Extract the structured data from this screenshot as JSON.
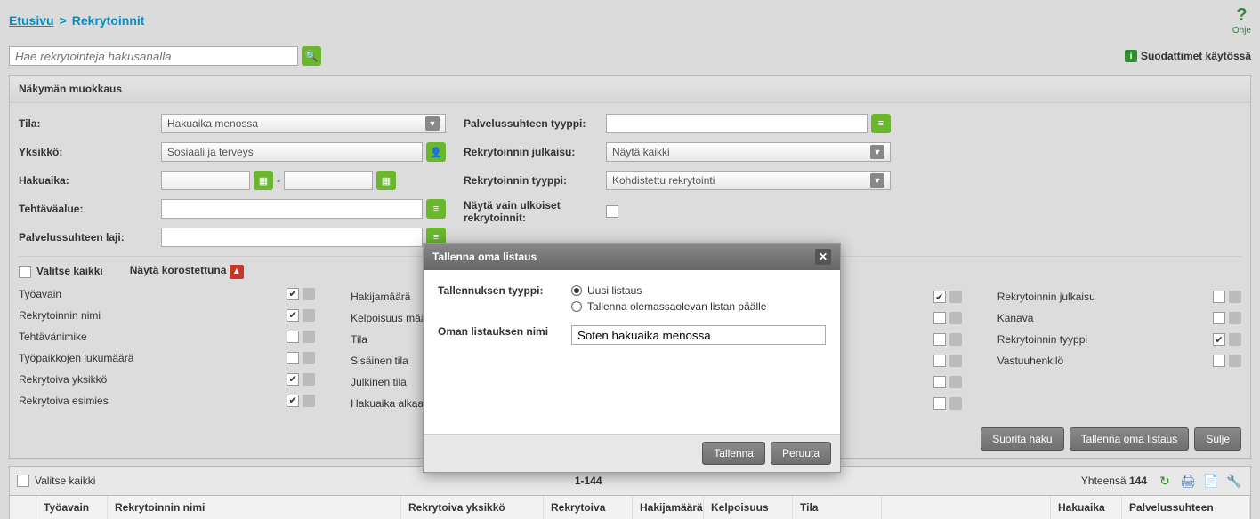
{
  "breadcrumb": {
    "home": "Etusivu",
    "sep": ">",
    "current": "Rekrytoinnit"
  },
  "help": {
    "label": "Ohje",
    "icon": "?"
  },
  "search": {
    "placeholder": "Hae rekrytointeja hakusanalla"
  },
  "filters_active": {
    "badge": "i",
    "text": "Suodattimet käytössä"
  },
  "panel": {
    "title": "Näkymän muokkaus"
  },
  "filters": {
    "tila": {
      "label": "Tila:",
      "value": "Hakuaika menossa"
    },
    "yksikko": {
      "label": "Yksikkö:",
      "value": "Sosiaali ja terveys"
    },
    "hakuaika": {
      "label": "Hakuaika:",
      "sep": "-"
    },
    "tehtavaalue": {
      "label": "Tehtäväalue:"
    },
    "palvelussuhteen_laji": {
      "label": "Palvelussuhteen laji:"
    },
    "palvelussuhteen_tyyppi": {
      "label": "Palvelussuhteen tyyppi:"
    },
    "rekrytoinnin_julkaisu": {
      "label": "Rekrytoinnin julkaisu:",
      "value": "Näytä kaikki"
    },
    "rekrytoinnin_tyyppi": {
      "label": "Rekrytoinnin tyyppi:",
      "value": "Kohdistettu rekrytointi"
    },
    "nayta_ulkoiset": {
      "label": "Näytä vain ulkoiset rekrytoinnit:"
    }
  },
  "columns": {
    "select_all": "Valitse kaikki",
    "highlight": "Näytä korostettuna",
    "col1": [
      {
        "label": "Työavain",
        "checked": true
      },
      {
        "label": "Rekrytoinnin nimi",
        "checked": true
      },
      {
        "label": "Tehtävänimike",
        "checked": false
      },
      {
        "label": "Työpaikkojen lukumäärä",
        "checked": false
      },
      {
        "label": "Rekrytoiva yksikkö",
        "checked": true
      },
      {
        "label": "Rekrytoiva esimies",
        "checked": true
      }
    ],
    "col2": [
      {
        "label": "Hakijamäärä",
        "checked": false
      },
      {
        "label": "Kelpoisuus määritelty",
        "checked": false
      },
      {
        "label": "Tila",
        "checked": false
      },
      {
        "label": "Sisäinen tila",
        "checked": false
      },
      {
        "label": "Julkinen tila",
        "checked": false
      },
      {
        "label": "Hakuaika alkaa",
        "checked": false
      }
    ],
    "col3": [
      {
        "label": "",
        "checked": true
      },
      {
        "label": "",
        "checked": false
      },
      {
        "label": "",
        "checked": false
      },
      {
        "label": "",
        "checked": false
      },
      {
        "label": "",
        "checked": false
      },
      {
        "label": "",
        "checked": false
      }
    ],
    "col4": [
      {
        "label": "Rekrytoinnin julkaisu",
        "checked": false
      },
      {
        "label": "Kanava",
        "checked": false
      },
      {
        "label": "Rekrytoinnin tyyppi",
        "checked": true
      },
      {
        "label": "Vastuuhenkilö",
        "checked": false
      }
    ]
  },
  "actions": {
    "suorita": "Suorita haku",
    "tallenna_listaus": "Tallenna oma listaus",
    "sulje": "Sulje"
  },
  "results": {
    "select_all": "Valitse kaikki",
    "page": "1-144",
    "total_label": "Yhteensä",
    "total_value": "144",
    "headers": {
      "tyoavain": "Työavain",
      "rekrytoinnin_nimi": "Rekrytoinnin nimi",
      "rekrytoiva_yksikko": "Rekrytoiva yksikkö",
      "rekrytoiva": "Rekrytoiva",
      "hakijamaara": "Hakijamäärä",
      "kelpoisuus": "Kelpoisuus",
      "tila": "Tila",
      "hakuaika": "Hakuaika",
      "palvelussuhteen": "Palvelussuhteen"
    }
  },
  "modal": {
    "title": "Tallenna oma listaus",
    "type_label": "Tallennuksen tyyppi:",
    "radio_new": "Uusi listaus",
    "radio_overwrite": "Tallenna olemassaolevan listan päälle",
    "name_label": "Oman listauksen nimi",
    "name_value": "Soten hakuaika menossa",
    "save": "Tallenna",
    "cancel": "Peruuta"
  }
}
